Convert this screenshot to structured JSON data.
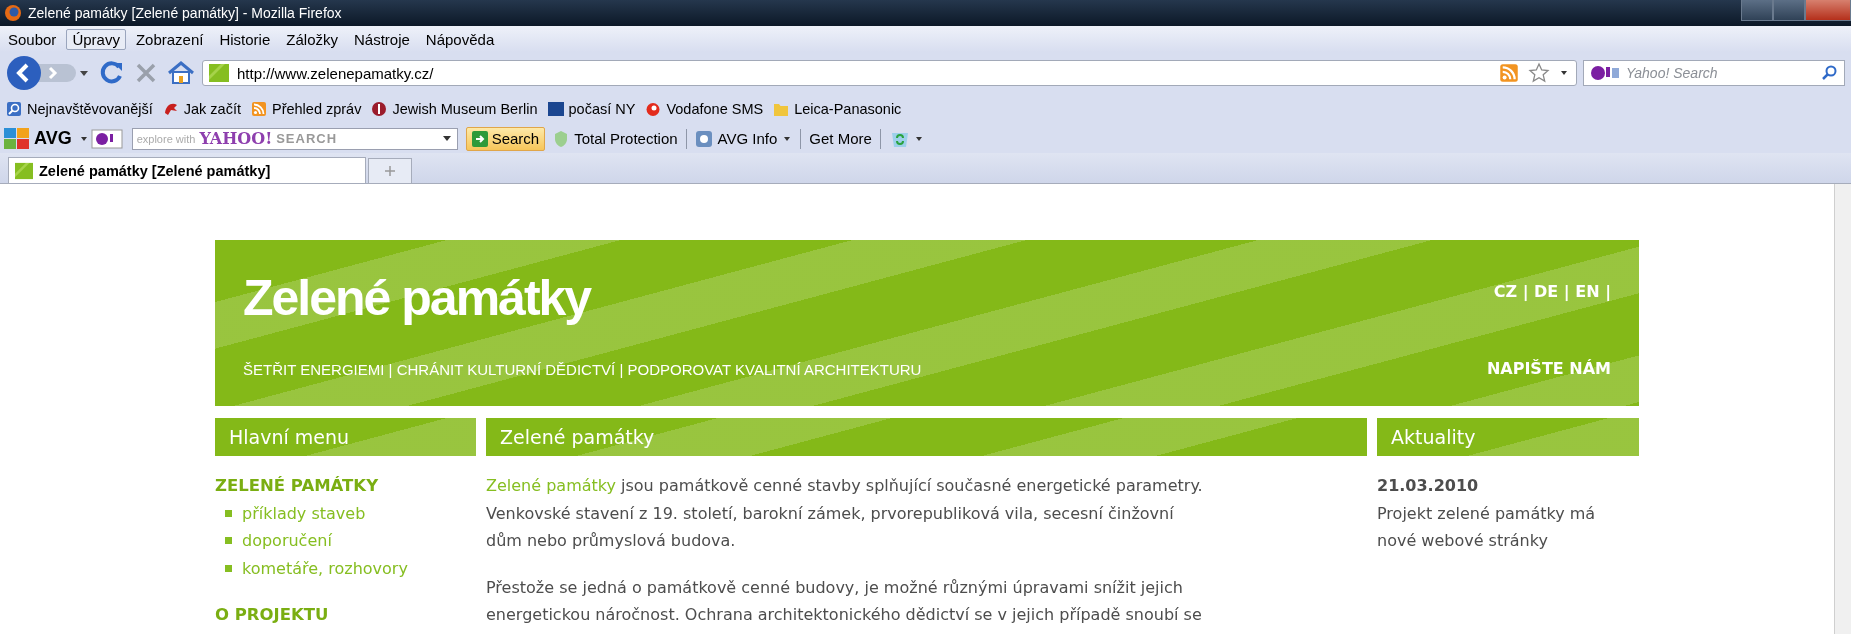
{
  "window": {
    "title": "Zelené památky [Zelené památky] - Mozilla Firefox"
  },
  "menu": [
    {
      "label": "Soubor",
      "highlighted": false
    },
    {
      "label": "Úpravy",
      "highlighted": true
    },
    {
      "label": "Zobrazení",
      "highlighted": false
    },
    {
      "label": "Historie",
      "highlighted": false
    },
    {
      "label": "Záložky",
      "highlighted": false
    },
    {
      "label": "Nástroje",
      "highlighted": false
    },
    {
      "label": "Nápověda",
      "highlighted": false
    }
  ],
  "navbar": {
    "url": "http://www.zelenepamatky.cz/",
    "search_placeholder": "Yahoo! Search"
  },
  "bookmarks": [
    "Nejnavštěvovanější",
    "Jak začít",
    "Přehled zpráv",
    "Jewish Museum Berlin",
    "počasí NY",
    "Vodafone SMS",
    "Leica-Panasonic"
  ],
  "avg_toolbar": {
    "brand": "AVG",
    "search_hint": "explore with",
    "search_logo": "YAHOO!",
    "search_logo_suffix": "SEARCH",
    "search_button": "Search",
    "items": [
      "Total Protection",
      "AVG Info",
      "Get More"
    ]
  },
  "tabs": [
    {
      "label": "Zelené památky [Zelené památky]",
      "selected": true
    }
  ],
  "site": {
    "title": "Zelené památky",
    "tagline": "ŠETŘIT ENERGIEMI | CHRÁNIT KULTURNÍ DĚDICTVÍ | PODPOROVAT KVALITNÍ ARCHITEKTURU",
    "languages": "CZ | DE | EN |",
    "contact": "NAPIŠTE NÁM",
    "sidebar": {
      "title": "Hlavní menu",
      "sections": [
        {
          "heading": "ZELENÉ PAMÁTKY",
          "items": [
            "příklady staveb",
            "doporučení",
            "kometáře, rozhovory"
          ]
        },
        {
          "heading": "O PROJEKTU"
        }
      ]
    },
    "main": {
      "title": "Zelené památky",
      "paragraphs": [
        {
          "link": "Zelené památky",
          "lines": [
            " jsou památkově cenné stavby splňující současné energetické parametry.",
            "Venkovské stavení z 19. století, barokní zámek, prvorepubliková vila, secesní činžovní",
            "dům nebo průmyslová budova."
          ]
        },
        {
          "lines": [
            "Přestože se jedná o památkově cenné budovy, je možné různými úpravami snížit jejich",
            "energetickou náročnost. Ochrana architektonického dědictví se v jejich případě snoubí se"
          ]
        }
      ]
    },
    "news": {
      "title": "Aktuality",
      "items": [
        {
          "date": "21.03.2010",
          "lines": [
            "Projekt zelené památky má",
            "nové webové stránky"
          ]
        }
      ]
    }
  }
}
